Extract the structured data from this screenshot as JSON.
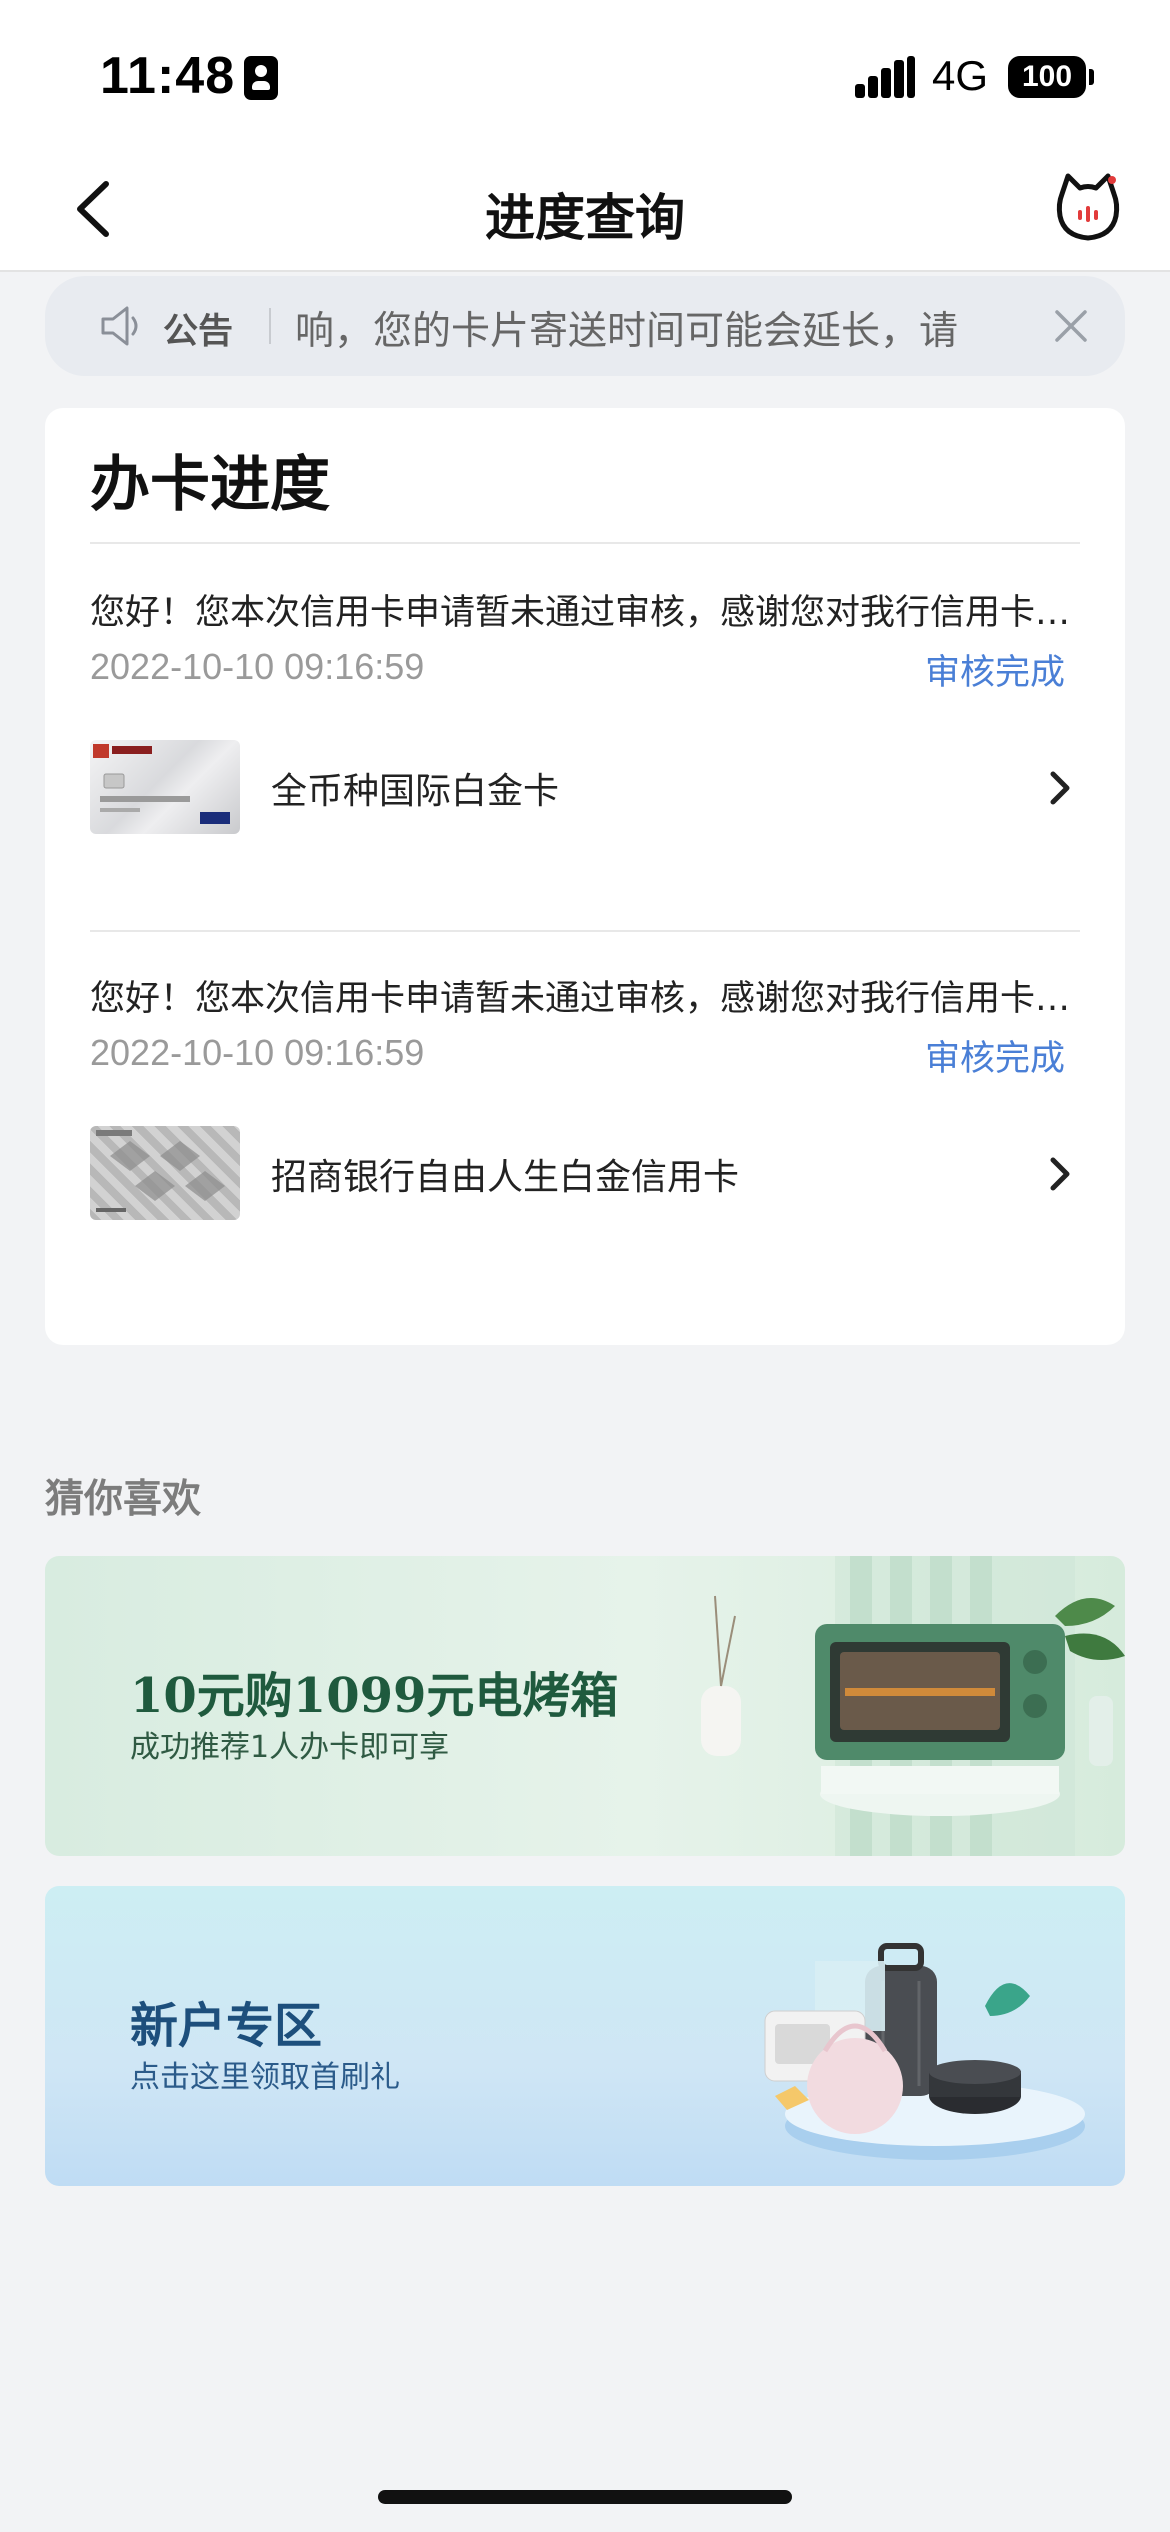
{
  "status_bar": {
    "time": "11:48",
    "network": "4G",
    "battery": "100",
    "icons": [
      "id-card-icon",
      "signal-icon",
      "battery-icon"
    ]
  },
  "nav": {
    "title": "进度查询",
    "back_icon": "chevron-left-icon",
    "service_icon": "cat-service-icon"
  },
  "notice": {
    "label": "公告",
    "text": "响，您的卡片寄送时间可能会延长，请",
    "icon": "speaker-icon",
    "close_icon": "close-icon"
  },
  "progress": {
    "title": "办卡进度",
    "items": [
      {
        "message": "您好！您本次信用卡申请暂未通过审核，感谢您对我行信用卡的支持。",
        "time": "2022-10-10 09:16:59",
        "status": "审核完成",
        "card_name": "全币种国际白金卡"
      },
      {
        "message": "您好！您本次信用卡申请暂未通过审核，感谢您对我行信用卡的支持。",
        "time": "2022-10-10 09:16:59",
        "status": "审核完成",
        "card_name": "招商银行自由人生白金信用卡"
      }
    ]
  },
  "recommend": {
    "title": "猜你喜欢",
    "banners": [
      {
        "title": "10元购1099元电烤箱",
        "subtitle": "成功推荐1人办卡即可享"
      },
      {
        "title": "新户专区",
        "subtitle": "点击这里领取首刷礼"
      }
    ]
  },
  "colors": {
    "accent_blue": "#4a7fd6",
    "page_bg": "#f2f3f5"
  }
}
